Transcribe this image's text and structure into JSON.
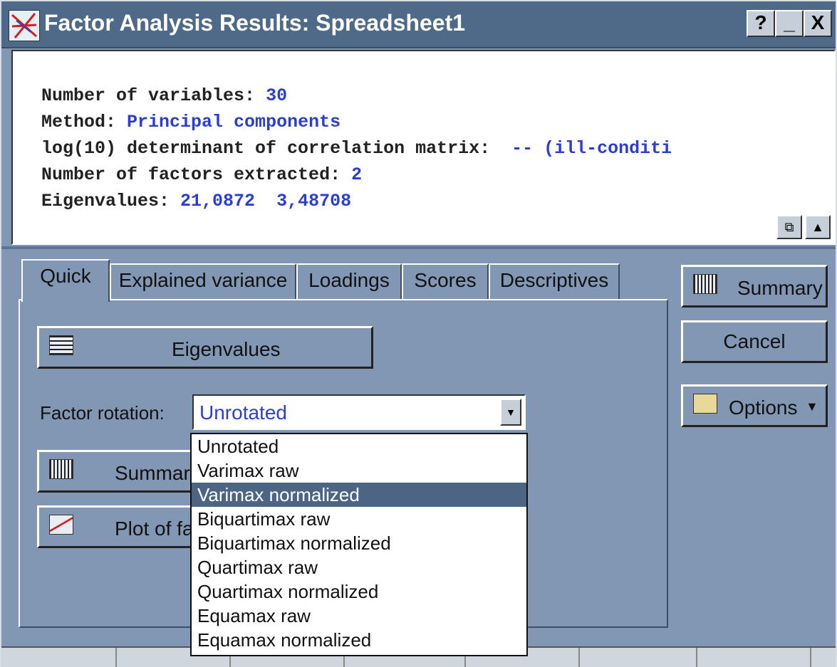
{
  "window": {
    "title": "Factor Analysis Results: Spreadsheet1",
    "controls": {
      "help": "?",
      "minimize": "_",
      "close": "X"
    }
  },
  "output": {
    "lines": [
      {
        "label": "Number of variables: ",
        "value": "30"
      },
      {
        "label": "Method: ",
        "value": "Principal components"
      },
      {
        "label": "log(10) determinant of correlation matrix:  ",
        "value": "-- (ill-conditi"
      },
      {
        "label": "Number of factors extracted: ",
        "value": "2"
      },
      {
        "label": "Eigenvalues: ",
        "value": "21,0872  3,48708"
      }
    ]
  },
  "tabs": [
    "Quick",
    "Explained variance",
    "Loadings",
    "Scores",
    "Descriptives"
  ],
  "quick": {
    "eigenvalues_button": "Eigenvalues",
    "rotation_label": "Factor rotation:",
    "rotation_value": "Unrotated",
    "summary_button": "Summary",
    "plot_button": "Plot of fa"
  },
  "rotation_options": [
    "Unrotated",
    "Varimax raw",
    "Varimax normalized",
    "Biquartimax raw",
    "Biquartimax normalized",
    "Quartimax raw",
    "Quartimax normalized",
    "Equamax raw",
    "Equamax normalized"
  ],
  "selected_option_index": 2,
  "side_buttons": {
    "summary": "Summary",
    "cancel": "Cancel",
    "options": "Options"
  },
  "colors": {
    "value_text": "#2a3ed6",
    "selection": "#4d6585",
    "titlebar": "#4f6988"
  }
}
